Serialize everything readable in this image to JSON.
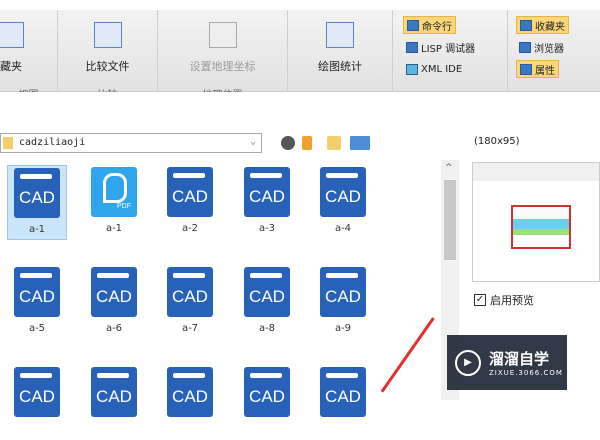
{
  "ribbon": {
    "groups": [
      {
        "label": "藏夹",
        "caption": "视图"
      },
      {
        "label": "比较文件",
        "caption": "比较"
      },
      {
        "label": "设置地理坐标",
        "caption": "地理位置"
      },
      {
        "label": "绘图统计",
        "caption": ""
      }
    ],
    "palettes": [
      {
        "label": "命令行",
        "highlight": true
      },
      {
        "label": "LISP 调试器",
        "highlight": false
      },
      {
        "label": "XML IDE",
        "highlight": false
      }
    ],
    "windows": [
      {
        "label": "收藏夹",
        "highlight": true
      },
      {
        "label": "浏览器",
        "highlight": false
      },
      {
        "label": "属性",
        "highlight": true
      }
    ]
  },
  "browser": {
    "path": "cadziliaoji",
    "files": [
      {
        "name": "a-1",
        "type": "CAD",
        "selected": true
      },
      {
        "name": "a-1",
        "type": "PDF"
      },
      {
        "name": "a-2",
        "type": "CAD"
      },
      {
        "name": "a-3",
        "type": "CAD"
      },
      {
        "name": "a-4",
        "type": "CAD"
      },
      {
        "name": "a-5",
        "type": "CAD"
      },
      {
        "name": "a-6",
        "type": "CAD"
      },
      {
        "name": "a-7",
        "type": "CAD"
      },
      {
        "name": "a-8",
        "type": "CAD"
      },
      {
        "name": "a-9",
        "type": "CAD"
      },
      {
        "name": "",
        "type": "CAD"
      },
      {
        "name": "",
        "type": "CAD"
      },
      {
        "name": "",
        "type": "CAD"
      },
      {
        "name": "",
        "type": "CAD"
      },
      {
        "name": "",
        "type": "CAD"
      }
    ]
  },
  "preview": {
    "size": "(180x95)",
    "enable_label": "启用预览",
    "enabled": true
  },
  "watermark": {
    "title": "溜溜自学",
    "url": "ZIXUE.3066.COM"
  }
}
